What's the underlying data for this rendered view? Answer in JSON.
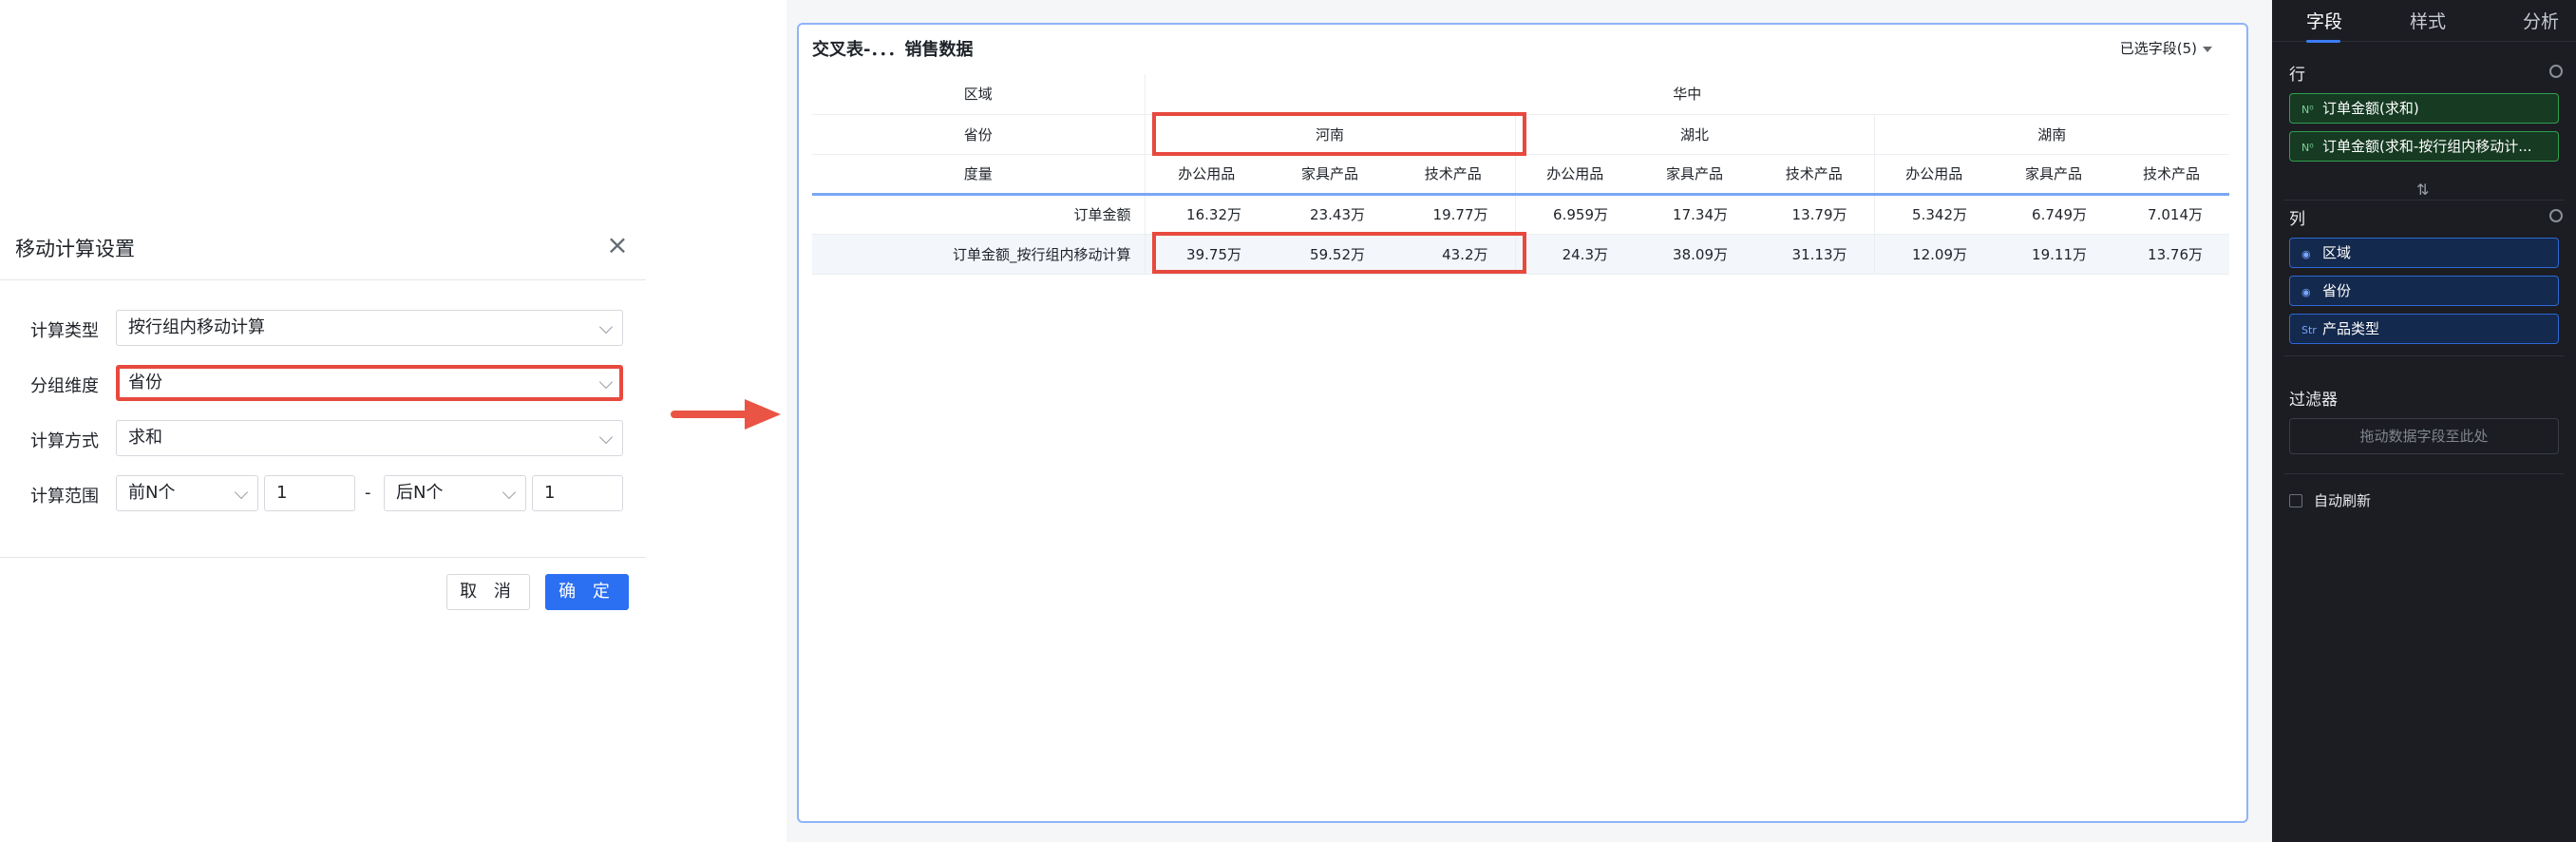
{
  "dialog": {
    "title": "移动计算设置",
    "fields": {
      "calc_type": {
        "label": "计算类型",
        "value": "按行组内移动计算"
      },
      "group_dim": {
        "label": "分组维度",
        "value": "省份"
      },
      "calc_method": {
        "label": "计算方式",
        "value": "求和"
      },
      "calc_range": {
        "label": "计算范围",
        "prev_select": "前N个",
        "prev_value": "1",
        "separator": "-",
        "next_select": "后N个",
        "next_value": "1"
      }
    },
    "cancel_label": "取 消",
    "ok_label": "确 定"
  },
  "card": {
    "title": "交叉表-．．．销售数据",
    "field_picker": "已选字段(5)",
    "header_labels": {
      "region": "区域",
      "province": "省份",
      "measure": "度量"
    },
    "region_value": "华中",
    "provinces": [
      "河南",
      "湖北",
      "湖南"
    ],
    "products": [
      "办公用品",
      "家具产品",
      "技术产品",
      "办公用品",
      "家具产品",
      "技术产品",
      "办公用品",
      "家具产品",
      "技术产品"
    ],
    "rows": [
      {
        "name": "订单金额",
        "values": [
          "16.32万",
          "23.43万",
          "19.77万",
          "6.959万",
          "17.34万",
          "13.79万",
          "5.342万",
          "6.749万",
          "7.014万"
        ]
      },
      {
        "name": "订单金额_按行组内移动计算",
        "values": [
          "39.75万",
          "59.52万",
          "43.2万",
          "24.3万",
          "38.09万",
          "31.13万",
          "12.09万",
          "19.11万",
          "13.76万"
        ]
      }
    ]
  },
  "panel": {
    "tabs": [
      "字段",
      "样式",
      "分析"
    ],
    "rows_label": "行",
    "row_chips": [
      {
        "icon": "N⁰",
        "label": "订单金额(求和)"
      },
      {
        "icon": "N⁰",
        "label": "订单金额(求和-按行组内移动计..."
      }
    ],
    "cols_label": "列",
    "col_chips": [
      {
        "icon": "◉",
        "label": "区域"
      },
      {
        "icon": "◉",
        "label": "省份"
      },
      {
        "icon": "Str",
        "label": "产品类型"
      }
    ],
    "filter_label": "过滤器",
    "filter_placeholder": "拖动数据字段至此处",
    "auto_refresh_label": "自动刷新",
    "swap_symbol": "⇅"
  },
  "colors": {
    "accent": "#2b6ff2",
    "highlight": "#e8493e",
    "panel_bg": "#1b1d23"
  }
}
